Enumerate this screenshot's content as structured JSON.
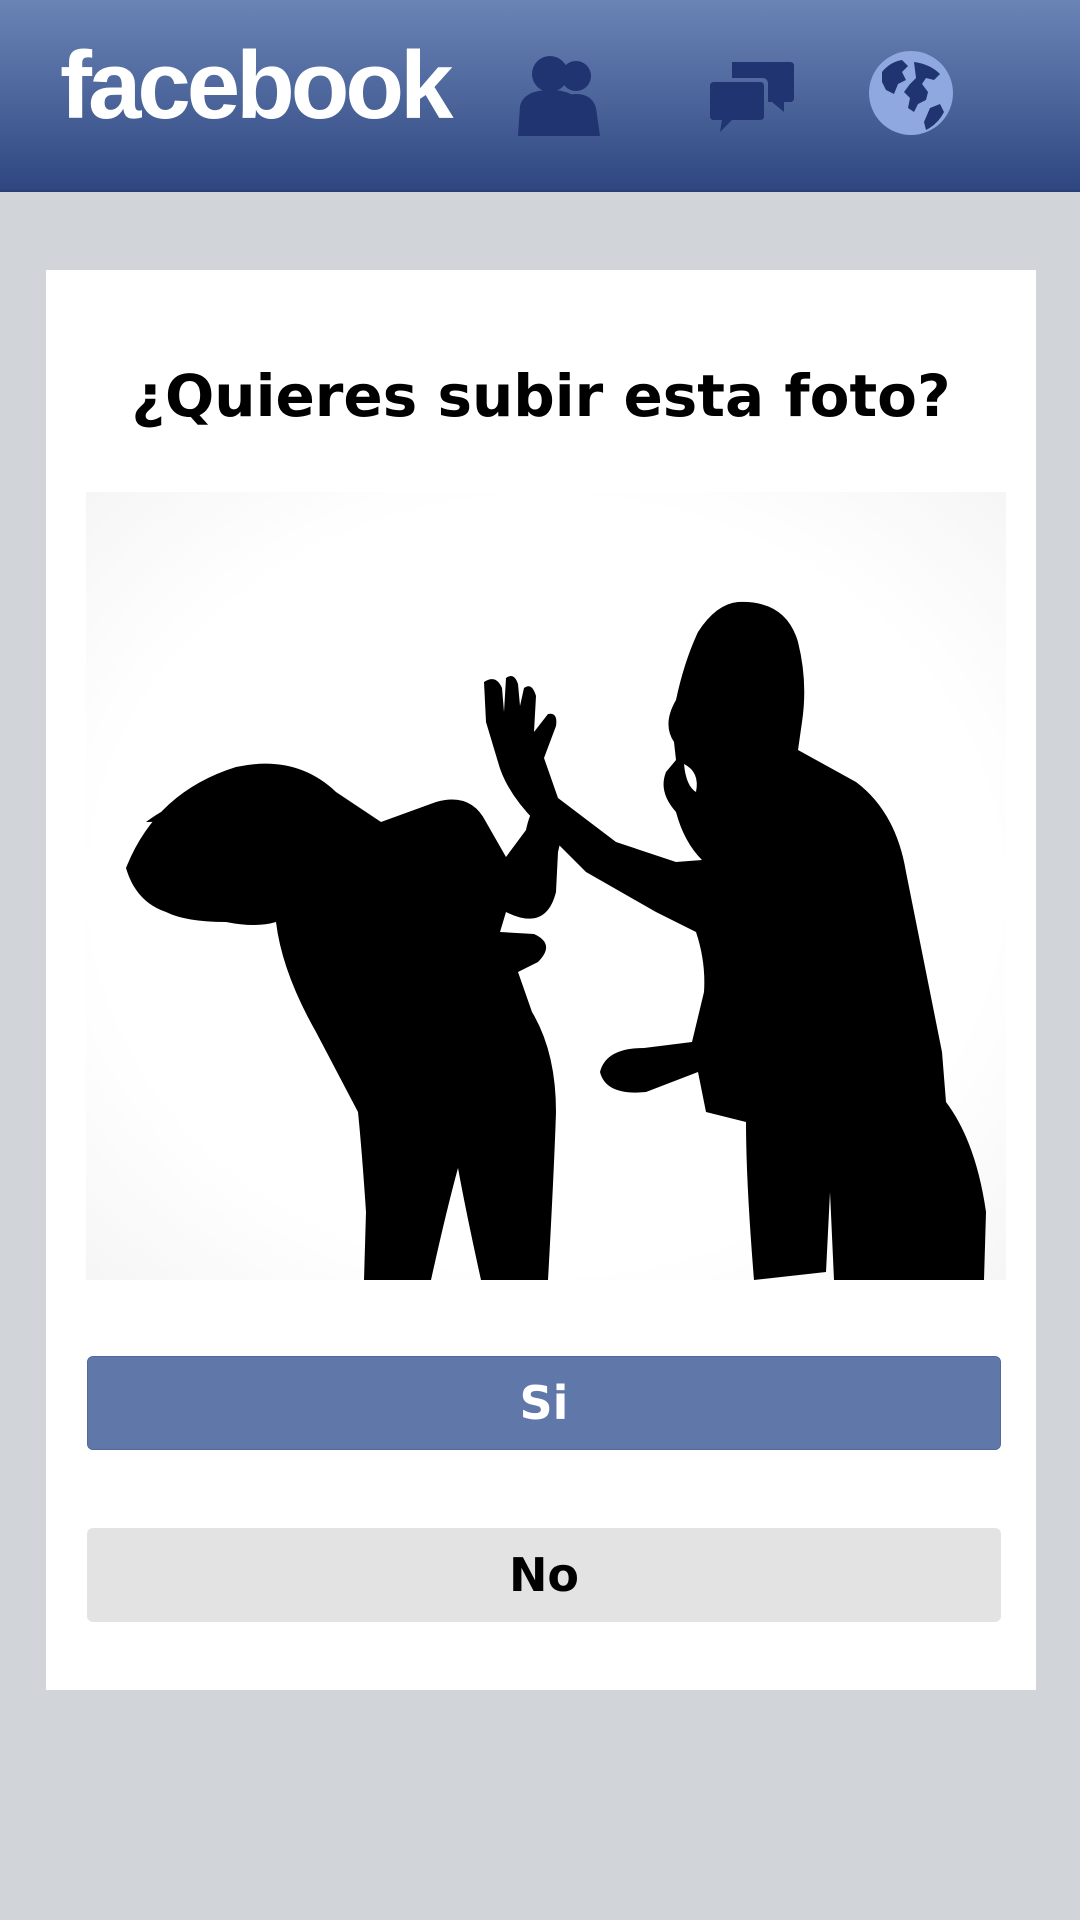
{
  "header": {
    "brand": "facebook",
    "icons": [
      "friends-icon",
      "messages-icon",
      "notifications-globe-icon"
    ]
  },
  "dialog": {
    "title": "¿Quieres subir esta foto?",
    "photo_icon": "photo-silhouette",
    "yes_label": "Si",
    "no_label": "No"
  },
  "colors": {
    "header_top": "#6a84b6",
    "header_bottom": "#2f4781",
    "background": "#d1d4d9",
    "primary_button": "#6077aa",
    "secondary_button": "#e3e3e3"
  }
}
